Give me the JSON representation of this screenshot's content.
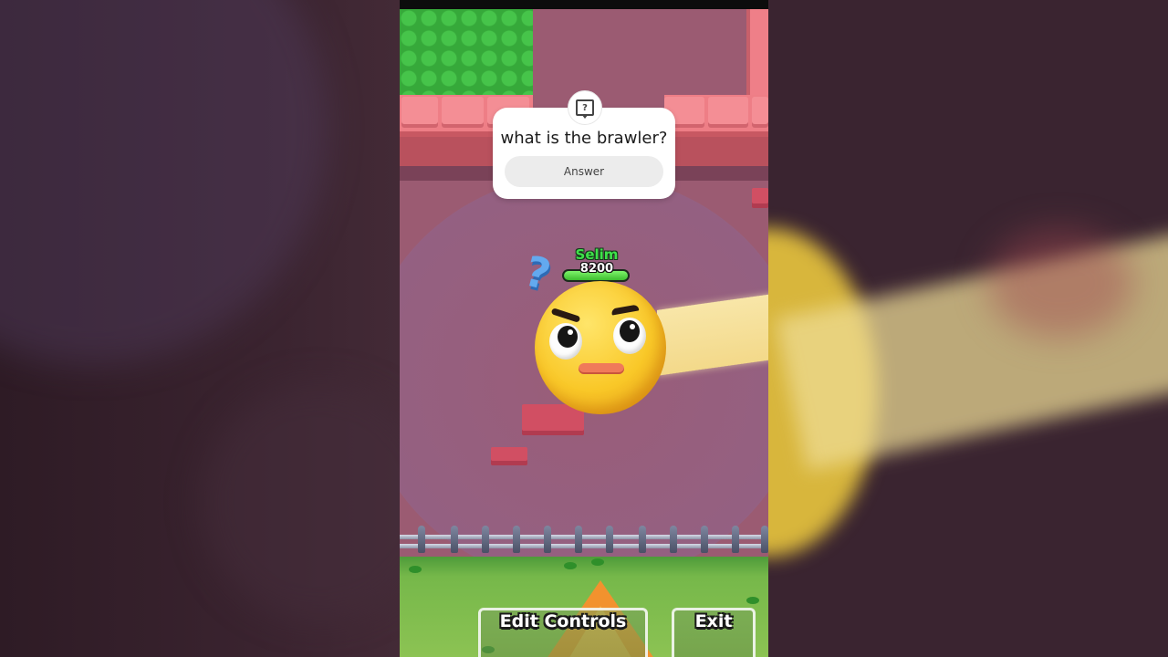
{
  "question_card": {
    "question": "what is the brawler?",
    "answer_placeholder": "Answer",
    "badge_icon": "question-sticker-icon"
  },
  "player": {
    "name": "Selim",
    "health": "8200",
    "health_fraction": 1.0,
    "status_icon": "question-mark-icon"
  },
  "controls": {
    "edit_controls_label": "Edit Controls",
    "exit_label": "Exit"
  },
  "colors": {
    "floor": "#9b5b72",
    "wall": "#ee7e86",
    "grass": "#36a93a",
    "player_name": "#3fe14a",
    "emoji": "#f9c828"
  }
}
